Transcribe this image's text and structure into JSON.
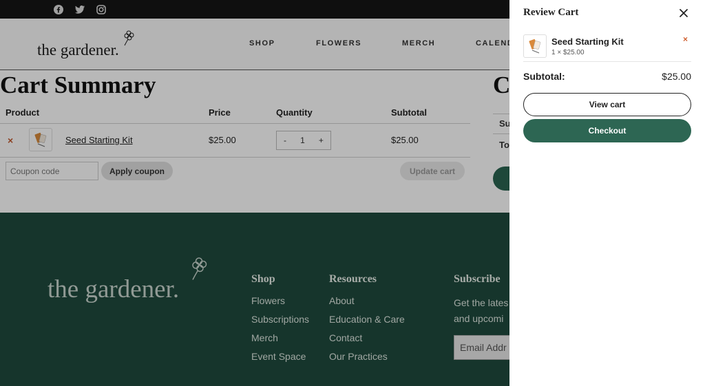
{
  "social": {
    "icons": [
      "facebook-icon",
      "twitter-icon",
      "instagram-icon"
    ]
  },
  "header": {
    "logo": "the gardener.",
    "nav": [
      "SHOP",
      "FLOWERS",
      "MERCH",
      "CALEND"
    ]
  },
  "cart": {
    "title": "Cart Summary",
    "totals_title_fragment": "C",
    "columns": [
      "Product",
      "Price",
      "Quantity",
      "Subtotal"
    ],
    "item": {
      "name": "Seed Starting Kit",
      "price": "$25.00",
      "qty": "1",
      "subtotal": "$25.00",
      "minus": "-",
      "plus": "+"
    },
    "remove": "×",
    "coupon_placeholder": "Coupon code",
    "apply_label": "Apply coupon",
    "update_label": "Update cart",
    "side_fragments": [
      "Su",
      "To"
    ]
  },
  "footer": {
    "logo": "the gardener.",
    "shop": {
      "heading": "Shop",
      "links": [
        "Flowers",
        "Subscriptions",
        "Merch",
        "Event Space"
      ]
    },
    "resources": {
      "heading": "Resources",
      "links": [
        "About",
        "Education & Care",
        "Contact",
        "Our Practices"
      ]
    },
    "subscribe": {
      "heading": "Subscribe",
      "text_line1": "Get the lates",
      "text_line2": "and upcomi",
      "email_placeholder": "Email Addr"
    }
  },
  "drawer": {
    "title": "Review Cart",
    "item_name": "Seed Starting Kit",
    "item_meta": "1 × $25.00",
    "remove": "×",
    "subtotal_label": "Subtotal:",
    "subtotal_value": "$25.00",
    "view_cart": "View cart",
    "checkout": "Checkout"
  },
  "colors": {
    "footer_bg": "#1f4a3d",
    "accent_green": "#2d6653",
    "remove_orange": "#d06030"
  }
}
